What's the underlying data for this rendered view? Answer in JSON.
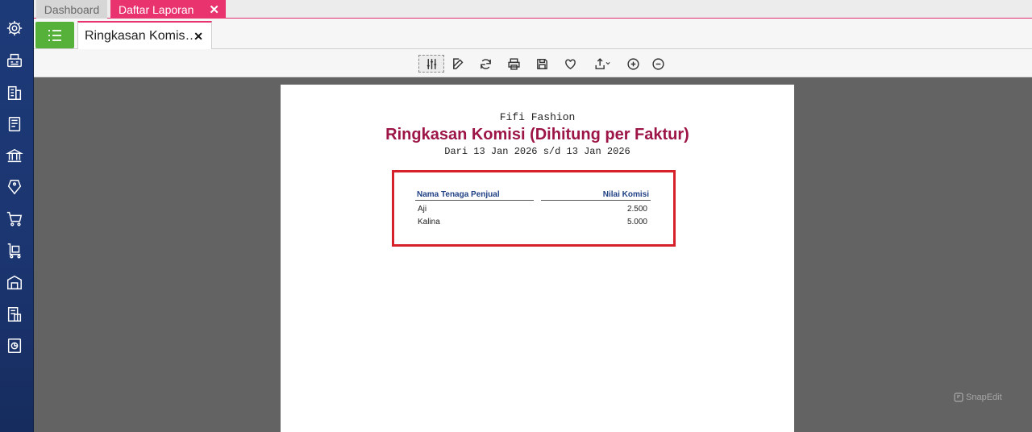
{
  "sidebar": {
    "icons": [
      "settings-icon",
      "fax-icon",
      "building-icon",
      "book-icon",
      "bank-icon",
      "price-tag-icon",
      "cart-icon",
      "delivery-cart-icon",
      "warehouse-icon",
      "tax-doc-icon",
      "report-icon"
    ]
  },
  "top_tabs": [
    {
      "label": "Dashboard"
    },
    {
      "label": "Daftar Laporan",
      "close": "✕"
    }
  ],
  "report_tab": {
    "label": "Ringkasan Komis…",
    "close": "✕"
  },
  "toolbar": {
    "buttons": [
      "filter-sliders-icon",
      "edit-icon",
      "refresh-icon",
      "print-icon",
      "save-icon",
      "favorite-heart-icon",
      "export-icon",
      "zoom-in-icon",
      "zoom-out-icon"
    ]
  },
  "report": {
    "company": "Fifi Fashion",
    "title": "Ringkasan Komisi (Dihitung per Faktur)",
    "period": "Dari 13 Jan 2026 s/d 13 Jan 2026",
    "columns": [
      "Nama Tenaga Penjual",
      "Nilai Komisi"
    ],
    "rows": [
      {
        "name": "Aji",
        "value": "2.500"
      },
      {
        "name": "Kalina",
        "value": "5.000"
      }
    ]
  },
  "watermark": "SnapEdit",
  "colors": {
    "accent_pink": "#e8336e",
    "sidebar_navy": "#1d3a78",
    "title_red": "#9c1546",
    "highlight_red": "#d6202a",
    "green": "#56b13a"
  }
}
